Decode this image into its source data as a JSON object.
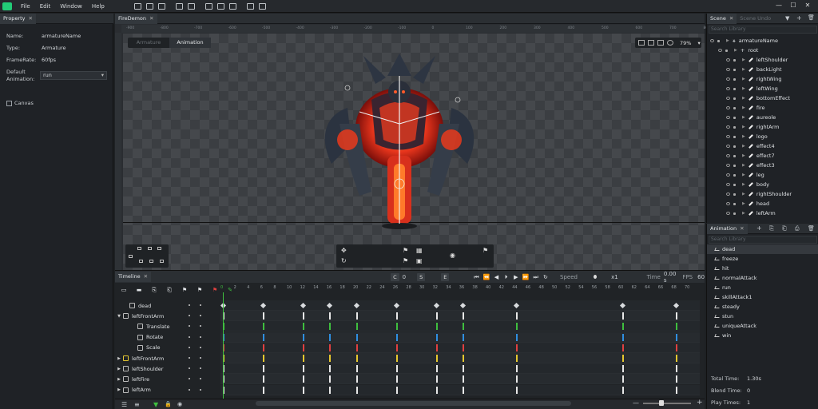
{
  "menu": [
    "File",
    "Edit",
    "Window",
    "Help"
  ],
  "window_controls": [
    "—",
    "☐",
    "✕"
  ],
  "property_panel": {
    "tab": "Property",
    "rows": [
      {
        "label": "Name:",
        "value": "armatureName"
      },
      {
        "label": "Type:",
        "value": "Armature"
      },
      {
        "label": "FrameRate:",
        "value": "60fps"
      }
    ],
    "default_animation_label_1": "Default",
    "default_animation_label_2": "Animation:",
    "default_animation_value": "run",
    "canvas_label": "Canvas"
  },
  "viewport": {
    "tab": "FireDemon",
    "mode_armature": "Armature",
    "mode_animation": "Animation",
    "zoom": "79%",
    "ruler_labels": [
      "-900",
      "-800",
      "-700",
      "-600",
      "-500",
      "-400",
      "-300",
      "-200",
      "-100",
      "0",
      "100",
      "200",
      "300",
      "400",
      "500",
      "600",
      "700",
      "800",
      "900"
    ]
  },
  "scene_panel": {
    "tab": "Scene",
    "tab2": "Scene Undo",
    "search_placeholder": "Search Library",
    "root_armature": "armatureName",
    "root": "root",
    "bones": [
      "leftShoulder",
      "backLight",
      "rightWing",
      "leftWing",
      "bottomEffect",
      "fire",
      "aureole",
      "rightArm",
      "logo",
      "effect4",
      "effect7",
      "effect3",
      "leg",
      "body",
      "rightShoulder",
      "head",
      "leftArm"
    ]
  },
  "animation_panel": {
    "tab": "Animation",
    "search_placeholder": "Search Library",
    "items": [
      "dead",
      "freeze",
      "hit",
      "normalAttack",
      "run",
      "skillAttack1",
      "steady",
      "stun",
      "uniqueAttack",
      "win"
    ],
    "selected": "dead",
    "total_time_label": "Total Time:",
    "total_time": "1.30s",
    "blend_time_label": "Blend Time:",
    "blend_time": "0",
    "play_times_label": "Play Times:",
    "play_times": "1"
  },
  "timeline": {
    "tab": "Timeline",
    "c_label": "C",
    "c_value": "0",
    "s_label": "S",
    "e_label": "E",
    "speed_label": "Speed",
    "speed_value": "x1",
    "time_label": "Time",
    "time_value": "0.00 s",
    "fps_label": "FPS",
    "fps_value": "60",
    "frame_numbers": [
      "0",
      "2",
      "4",
      "6",
      "8",
      "10",
      "12",
      "14",
      "16",
      "18",
      "20",
      "22",
      "24",
      "26",
      "28",
      "30",
      "32",
      "34",
      "36",
      "38",
      "40",
      "42",
      "44",
      "46",
      "48",
      "50",
      "52",
      "54",
      "56",
      "58",
      "60",
      "62",
      "64",
      "66",
      "68",
      "70"
    ],
    "tracks": [
      {
        "name": "dead",
        "type": "anim"
      },
      {
        "name": "leftFrontArm",
        "type": "bone"
      },
      {
        "name": "Translate",
        "type": "translate"
      },
      {
        "name": "Rotate",
        "type": "rotate"
      },
      {
        "name": "Scale",
        "type": "scale"
      },
      {
        "name": "leftFrontArm",
        "type": "slot"
      },
      {
        "name": "leftShoulder",
        "type": "bone"
      },
      {
        "name": "leftFire",
        "type": "bone"
      },
      {
        "name": "leftArm",
        "type": "bone"
      }
    ],
    "key_frames": [
      0,
      6,
      12,
      16,
      20,
      26,
      32,
      36,
      44,
      60,
      68
    ],
    "channel_colors": {
      "translate": "#3fbf3f",
      "rotate": "#2f8fe0",
      "scale": "#e04040",
      "slot": "#e6c830",
      "bone": "#e8e8e8"
    }
  },
  "colors": {
    "accent_green": "#3fbf3f",
    "panel_bg": "#1f2226",
    "selected_row": "#35393e"
  }
}
